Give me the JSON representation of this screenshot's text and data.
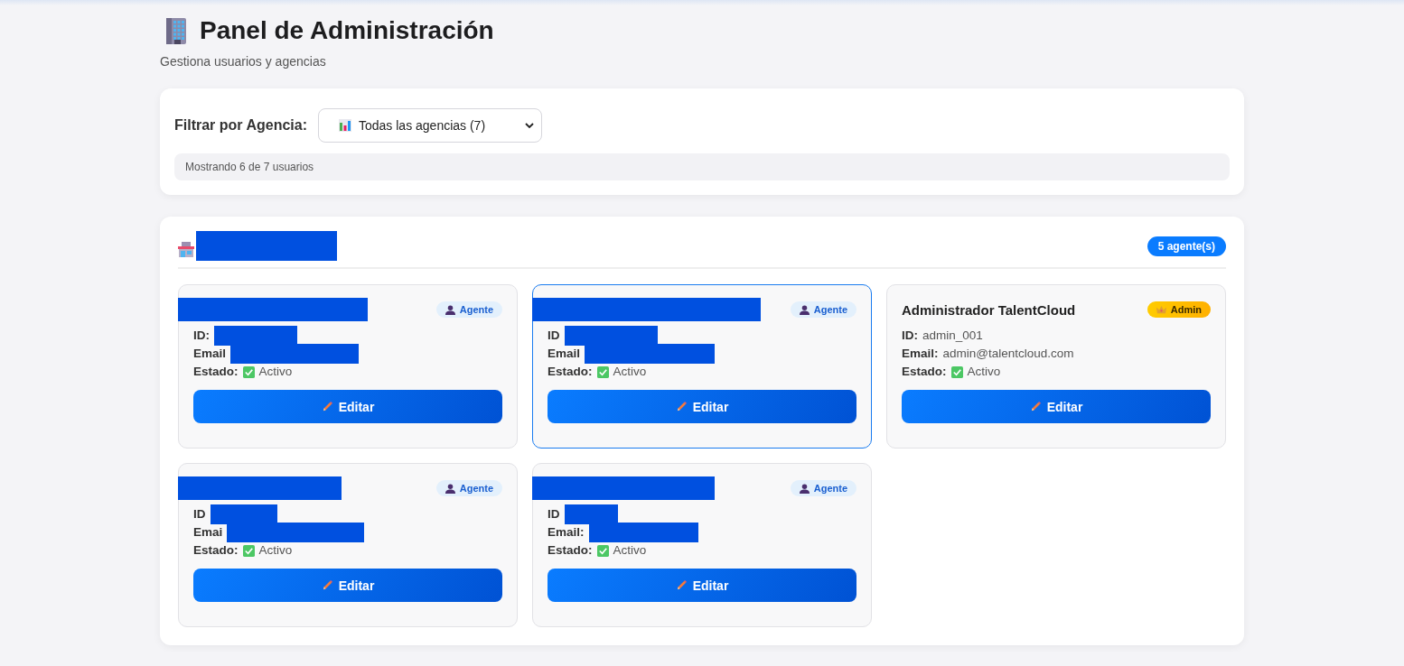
{
  "header": {
    "title": "Panel de Administración",
    "subtitle": "Gestiona usuarios y agencias"
  },
  "filter": {
    "label": "Filtrar por Agencia:",
    "value": "Todas las agencias (7)",
    "summary": "Mostrando 6 de 7 usuarios"
  },
  "agency": {
    "name_redacted": true,
    "count": "5 agente(s)",
    "users": [
      {
        "kind": "agent",
        "role_label": "Agente",
        "redacted": true,
        "selected": false,
        "id_label": "ID:",
        "email_label": "Email",
        "status_label": "Estado:",
        "status": "Activo",
        "active": true,
        "button": "Editar"
      },
      {
        "kind": "agent",
        "role_label": "Agente",
        "redacted": true,
        "selected": true,
        "id_label": "ID",
        "email_label": "Email",
        "status_label": "Estado:",
        "status": "Activo",
        "active": true,
        "button": "Editar"
      },
      {
        "kind": "admin",
        "role_label": "Admin",
        "redacted": false,
        "selected": false,
        "name": "Administrador TalentCloud",
        "id_label": "ID:",
        "id": "admin_001",
        "email_label": "Email:",
        "email": "admin@talentcloud.com",
        "status_label": "Estado:",
        "status": "Activo",
        "active": true,
        "button": "Editar"
      },
      {
        "kind": "agent",
        "role_label": "Agente",
        "redacted": true,
        "selected": false,
        "id_label": "ID",
        "email_label": "Emai",
        "status_label": "Estado:",
        "status": "Activo",
        "active": true,
        "button": "Editar"
      },
      {
        "kind": "agent",
        "role_label": "Agente",
        "redacted": true,
        "selected": false,
        "id_label": "ID",
        "email_label": "Email:",
        "status_label": "Estado:",
        "status": "Activo",
        "active": true,
        "button": "Editar"
      }
    ]
  }
}
